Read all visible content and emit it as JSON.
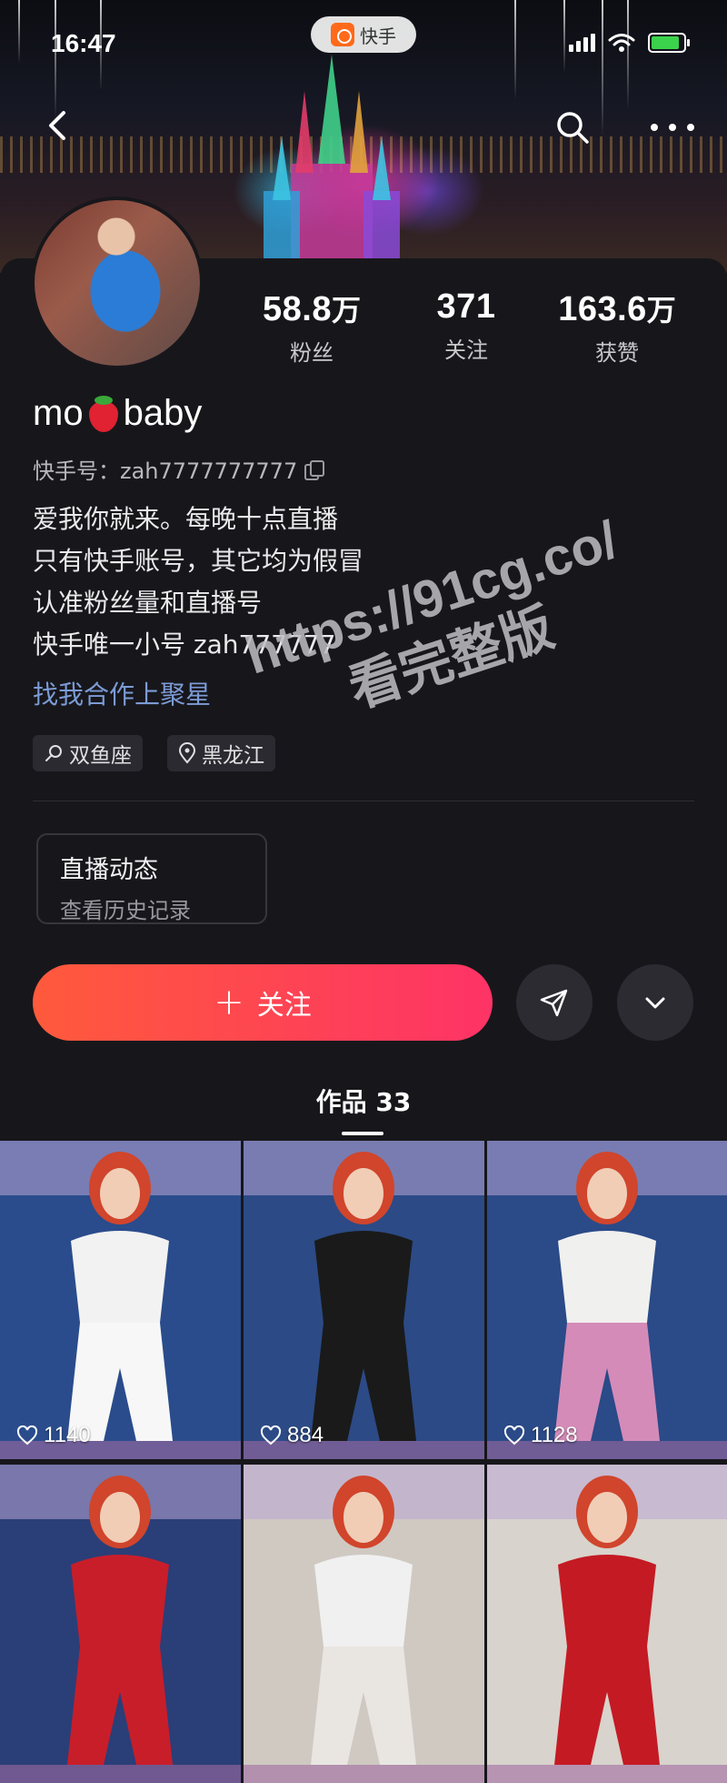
{
  "status_bar": {
    "time": "16:47",
    "app_name": "快手"
  },
  "profile": {
    "name_prefix": "mo",
    "name_suffix": "baby",
    "name_emoji": "strawberry-icon",
    "kuaishou_id": "快手号：zah7777777777",
    "bio_lines": [
      "爱我你就来。每晚十点直播",
      "只有快手账号，其它均为假冒",
      "认准粉丝量和直播号",
      "快手唯一小号 zah777777"
    ],
    "link_text": "找我合作上聚星",
    "tags": [
      {
        "icon": "zodiac-icon",
        "label": "双鱼座"
      },
      {
        "icon": "location-pin-icon",
        "label": "黑龙江"
      }
    ]
  },
  "stats": [
    {
      "value": "58.8",
      "unit": "万",
      "label": "粉丝"
    },
    {
      "value": "371",
      "unit": "",
      "label": "关注"
    },
    {
      "value": "163.6",
      "unit": "万",
      "label": "获赞"
    }
  ],
  "live_card": {
    "title": "直播动态",
    "subtitle": "查看历史记录"
  },
  "actions": {
    "follow_label": "关注",
    "follow_icon": "plus-icon",
    "share_icon": "send-icon",
    "more_icon": "chevron-down-icon"
  },
  "tabs": [
    {
      "label": "作品 33"
    }
  ],
  "works": [
    {
      "likes": "1140",
      "colors": {
        "bg": "#2a4c8c",
        "top": "#f2f2f2",
        "bottom": "#f7f7f7"
      }
    },
    {
      "likes": "884",
      "colors": {
        "bg": "#2c4a86",
        "top": "#1a1a1a",
        "bottom": "#1a1a1a"
      }
    },
    {
      "likes": "1128",
      "colors": {
        "bg": "#2a4a88",
        "top": "#f0f0ee",
        "bottom": "#d58bb8"
      }
    },
    {
      "likes": "",
      "colors": {
        "bg": "#2a3e78",
        "top": "#c81e2a",
        "bottom": "#c81e2a"
      }
    },
    {
      "likes": "",
      "colors": {
        "bg": "#cfc9c2",
        "top": "#f0f0f0",
        "bottom": "#e9e6e2"
      }
    },
    {
      "likes": "",
      "colors": {
        "bg": "#d8d3cc",
        "top": "#c41a24",
        "bottom": "#c41a24"
      }
    }
  ],
  "watermark": {
    "line1": "https://91cg.co/",
    "line2": "看完整版"
  }
}
